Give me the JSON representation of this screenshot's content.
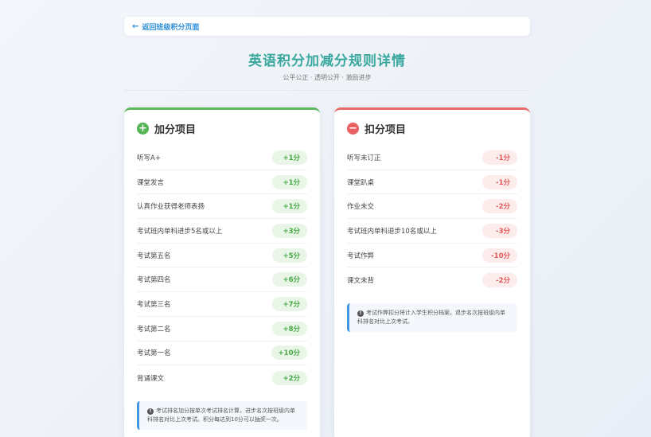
{
  "header": {
    "back_label": "返回班级积分页面",
    "title": "英语积分加减分规则详情",
    "subtitle": "公平公正 · 透明公开 · 激励进步"
  },
  "plus_card": {
    "title": "加分项目",
    "items": [
      {
        "label": "听写A+",
        "points": "+1分"
      },
      {
        "label": "课堂发言",
        "points": "+1分"
      },
      {
        "label": "认真作业获得老师表扬",
        "points": "+1分"
      },
      {
        "label": "考试班内单科进步5名或以上",
        "points": "+3分"
      },
      {
        "label": "考试第五名",
        "points": "+5分"
      },
      {
        "label": "考试第四名",
        "points": "+6分"
      },
      {
        "label": "考试第三名",
        "points": "+7分"
      },
      {
        "label": "考试第二名",
        "points": "+8分"
      },
      {
        "label": "考试第一名",
        "points": "+10分"
      },
      {
        "label": "背诵课文",
        "points": "+2分"
      }
    ],
    "note": "考试排名加分按单次考试排名计算，进步名次按班级内单科排名对比上次考试。积分每达到10分可以抽奖一次。"
  },
  "minus_card": {
    "title": "扣分项目",
    "items": [
      {
        "label": "听写未订正",
        "points": "-1分"
      },
      {
        "label": "课堂趴桌",
        "points": "-1分"
      },
      {
        "label": "作业未交",
        "points": "-2分"
      },
      {
        "label": "考试班内单科退步10名或以上",
        "points": "-3分"
      },
      {
        "label": "考试作弊",
        "points": "-10分"
      },
      {
        "label": "课文未背",
        "points": "-2分"
      }
    ],
    "note": "考试作弊扣分将计入学生积分档案，退步名次按班级内单科排名对比上次考试。"
  },
  "colors": {
    "accent": "#3aa89e",
    "link": "#2f8fd8",
    "plus": "#52b452",
    "minus": "#e86060"
  },
  "icons": {
    "back": "arrow-left-icon",
    "plus": "plus-circle-icon",
    "minus": "minus-circle-icon",
    "info": "info-icon"
  }
}
